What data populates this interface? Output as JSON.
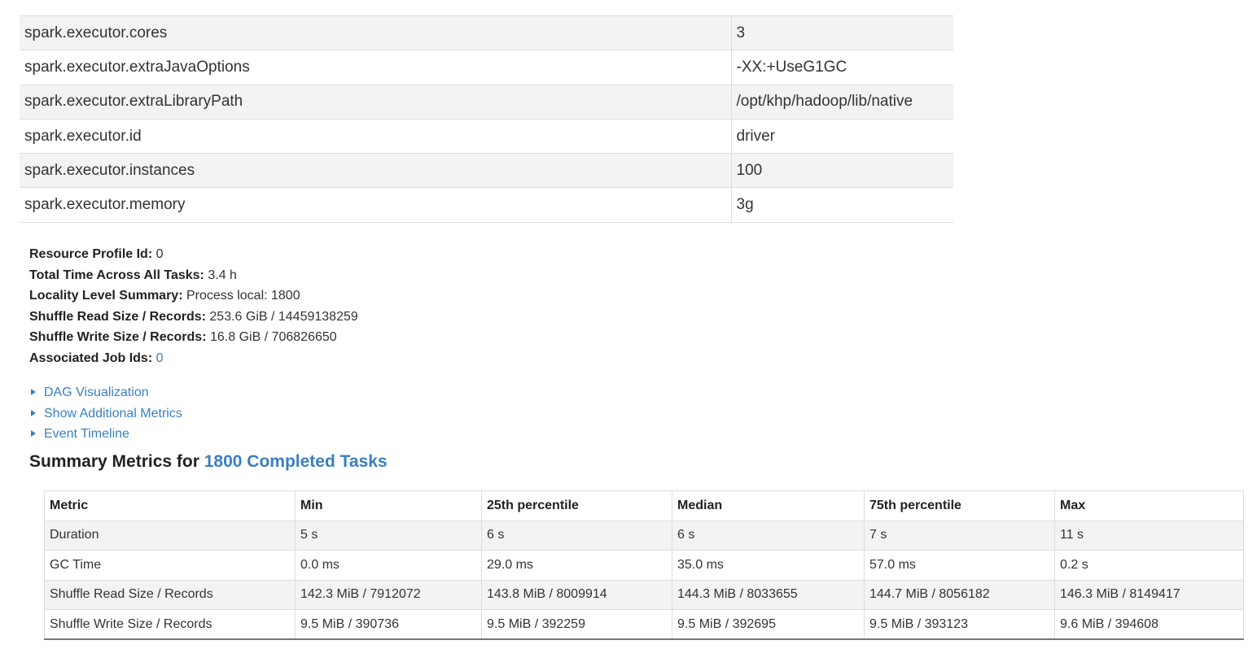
{
  "properties": [
    {
      "name": "spark.executor.cores",
      "value": "3"
    },
    {
      "name": "spark.executor.extraJavaOptions",
      "value": "-XX:+UseG1GC"
    },
    {
      "name": "spark.executor.extraLibraryPath",
      "value": "/opt/khp/hadoop/lib/native"
    },
    {
      "name": "spark.executor.id",
      "value": "driver"
    },
    {
      "name": "spark.executor.instances",
      "value": "100"
    },
    {
      "name": "spark.executor.memory",
      "value": "3g"
    }
  ],
  "summary": {
    "resource_profile_label": "Resource Profile Id:",
    "resource_profile_value": "0",
    "total_time_label": "Total Time Across All Tasks:",
    "total_time_value": "3.4 h",
    "locality_label": "Locality Level Summary:",
    "locality_value": "Process local: 1800",
    "shuffle_read_label": "Shuffle Read Size / Records:",
    "shuffle_read_value": "253.6 GiB / 14459138259",
    "shuffle_write_label": "Shuffle Write Size / Records:",
    "shuffle_write_value": "16.8 GiB / 706826650",
    "job_ids_label": "Associated Job Ids:",
    "job_ids_value": "0"
  },
  "expanders": {
    "dag": "DAG Visualization",
    "additional_metrics": "Show Additional Metrics",
    "event_timeline": "Event Timeline"
  },
  "metrics": {
    "heading_prefix": "Summary Metrics for",
    "heading_link": "1800 Completed Tasks",
    "columns": [
      "Metric",
      "Min",
      "25th percentile",
      "Median",
      "75th percentile",
      "Max"
    ],
    "rows": [
      [
        "Duration",
        "5 s",
        "6 s",
        "6 s",
        "7 s",
        "11 s"
      ],
      [
        "GC Time",
        "0.0 ms",
        "29.0 ms",
        "35.0 ms",
        "57.0 ms",
        "0.2 s"
      ],
      [
        "Shuffle Read Size / Records",
        "142.3 MiB / 7912072",
        "143.8 MiB / 8009914",
        "144.3 MiB / 8033655",
        "144.7 MiB / 8056182",
        "146.3 MiB / 8149417"
      ],
      [
        "Shuffle Write Size / Records",
        "9.5 MiB / 390736",
        "9.5 MiB / 392259",
        "9.5 MiB / 392695",
        "9.5 MiB / 393123",
        "9.6 MiB / 394608"
      ]
    ]
  }
}
